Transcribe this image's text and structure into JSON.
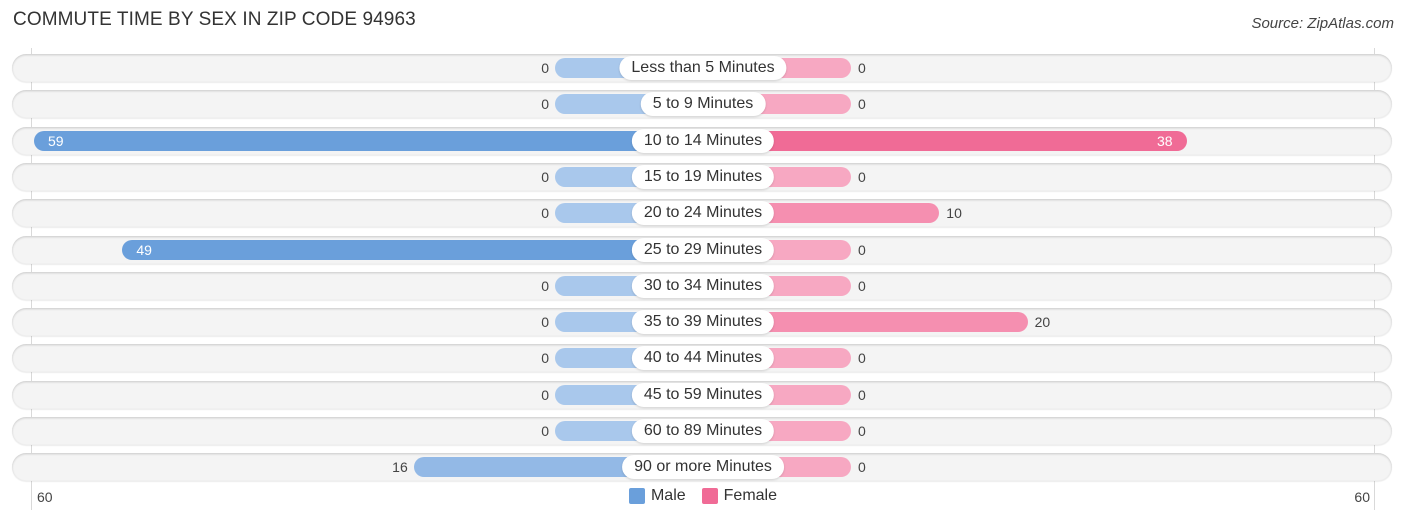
{
  "chart_data": {
    "type": "bar",
    "orientation": "horizontal-diverging",
    "title": "COMMUTE TIME BY SEX IN ZIP CODE 94963",
    "source": "Source: ZipAtlas.com",
    "categories": [
      "Less than 5 Minutes",
      "5 to 9 Minutes",
      "10 to 14 Minutes",
      "15 to 19 Minutes",
      "20 to 24 Minutes",
      "25 to 29 Minutes",
      "30 to 34 Minutes",
      "35 to 39 Minutes",
      "40 to 44 Minutes",
      "45 to 59 Minutes",
      "60 to 89 Minutes",
      "90 or more Minutes"
    ],
    "series": [
      {
        "name": "Male",
        "color": "#6a9fdb",
        "values": [
          0,
          0,
          59,
          0,
          0,
          49,
          0,
          0,
          0,
          0,
          0,
          16
        ]
      },
      {
        "name": "Female",
        "color": "#f06b96",
        "values": [
          0,
          0,
          38,
          0,
          10,
          0,
          0,
          20,
          0,
          0,
          0,
          0
        ]
      }
    ],
    "axis_range": [
      60,
      60
    ],
    "axis_tick_left": "60",
    "axis_tick_right": "60",
    "legend": [
      "Male",
      "Female"
    ],
    "legend_position": "bottom-center",
    "grid": false
  }
}
